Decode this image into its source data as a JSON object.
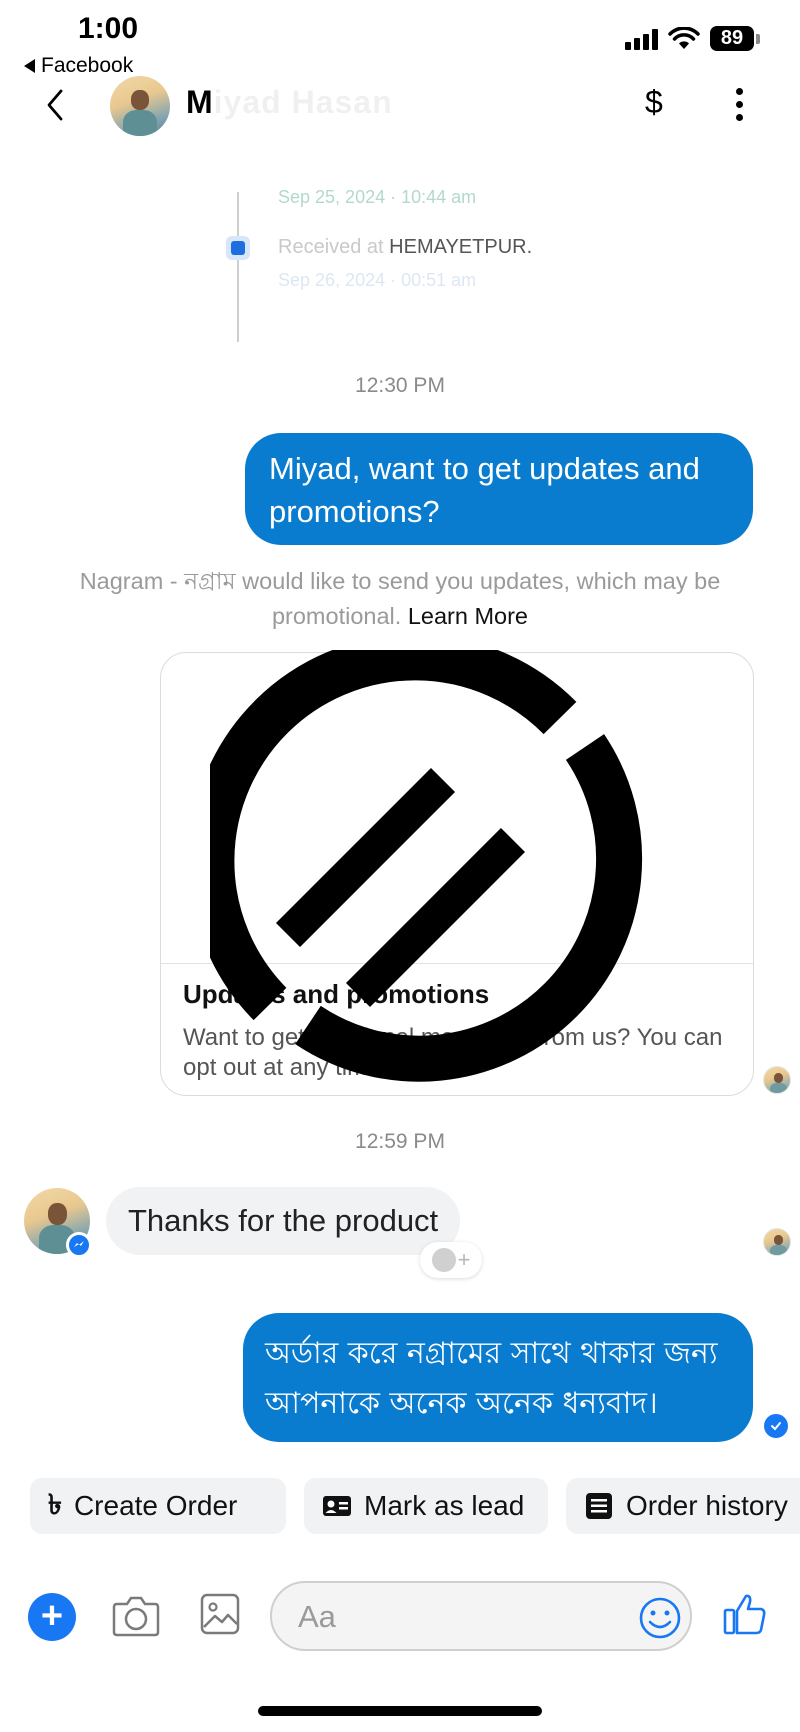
{
  "status_bar": {
    "time": "1:00",
    "back_app": "Facebook",
    "battery": "89"
  },
  "header": {
    "contact_name_visible": "M",
    "contact_name_blurred": "iyad Hasan",
    "payment_icon": "$",
    "icons": [
      "back-chevron-icon",
      "dollar-icon",
      "more-vertical-icon"
    ]
  },
  "tracking_image": {
    "line1": "Sep 25, 2024 · 10:44 am",
    "line2_prefix": "Received at ",
    "line2_place": "HEMAYETPUR.",
    "line3": "Sep 26, 2024 · 00:51 am"
  },
  "thread": {
    "timestamp_1": "12:30 PM",
    "outgoing_1": "Miyad, want to get updates and promotions?",
    "notice_text": "Nagram - নগ্রাম would like to send you updates, which may be promotional.",
    "notice_link": "Learn More",
    "card": {
      "title": "Updates and promotions",
      "description": "Want to get additional messages from us? You can opt out at any time."
    },
    "timestamp_2": "12:59 PM",
    "incoming_1": "Thanks for the product",
    "outgoing_2": "অর্ডার করে নগ্রামের সাথে থাকার জন্য আপনাকে অনেক অনেক ধন্যবাদ।"
  },
  "quick_actions": {
    "create_order": "Create Order",
    "mark_as_lead": "Mark as lead",
    "order_history": "Order history"
  },
  "composer": {
    "placeholder": "Aa"
  },
  "colors": {
    "outgoing_bubble": "#0a7cd0",
    "incoming_bubble": "#f1f2f4",
    "accent": "#1877f2"
  }
}
